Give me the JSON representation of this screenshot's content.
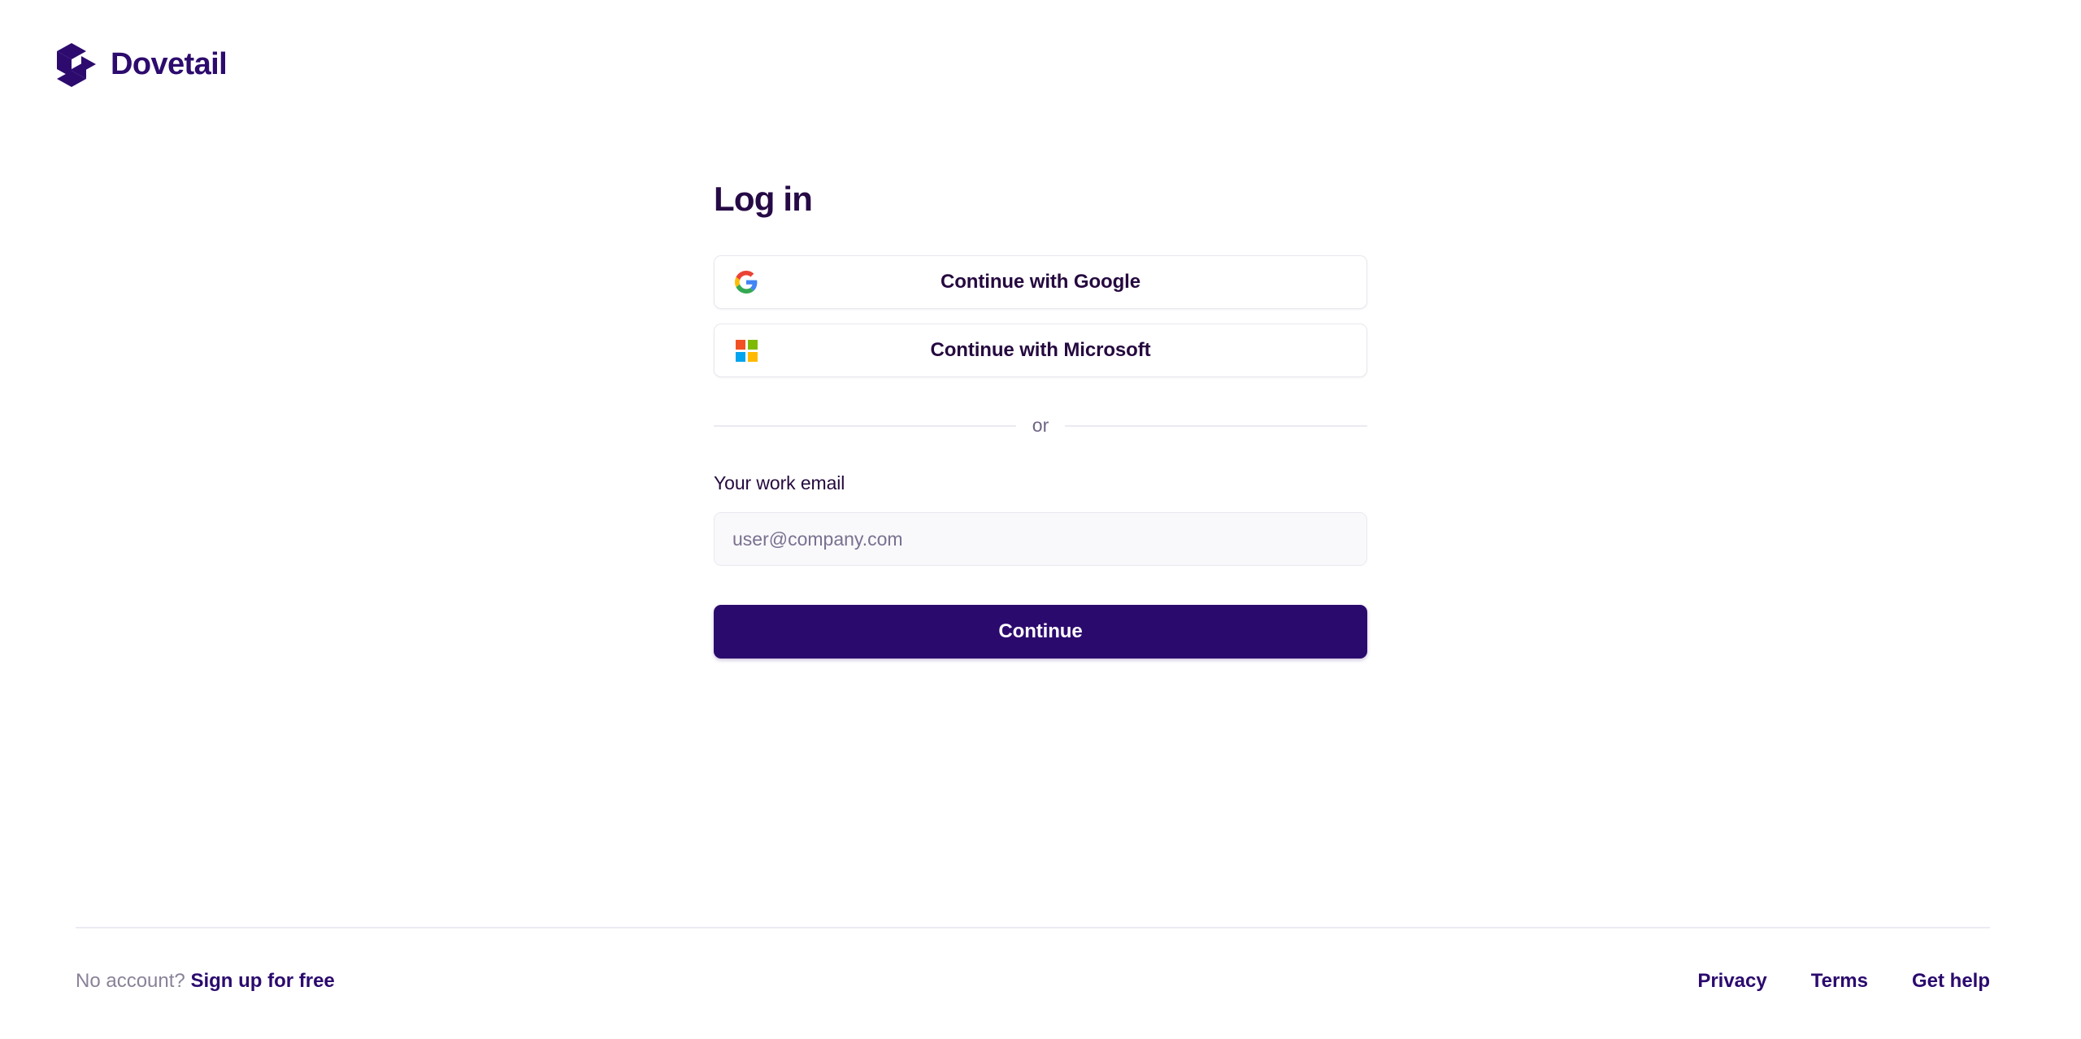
{
  "brand": {
    "name": "Dovetail",
    "logo_icon": "dovetail-logo-mark",
    "color": "#2d0b6e"
  },
  "main": {
    "title": "Log in",
    "social_buttons": [
      {
        "label": "Continue with Google",
        "icon": "google-icon"
      },
      {
        "label": "Continue with Microsoft",
        "icon": "microsoft-icon"
      }
    ],
    "divider_text": "or",
    "email_label": "Your work email",
    "email_placeholder": "user@company.com",
    "email_value": "",
    "submit_label": "Continue"
  },
  "footer": {
    "no_account_text": "No account?",
    "signup_label": "Sign up for free",
    "links": [
      {
        "label": "Privacy"
      },
      {
        "label": "Terms"
      },
      {
        "label": "Get help"
      }
    ]
  },
  "colors": {
    "primary": "#2b0a6e",
    "heading": "#260a45",
    "muted": "#8a8299",
    "placeholder": "#7a7090",
    "border": "#e9e7ef",
    "google_red": "#ea4335",
    "google_yellow": "#fbbc05",
    "google_green": "#34a853",
    "google_blue": "#4285f4",
    "ms_orange": "#f25022",
    "ms_green": "#7fba00",
    "ms_blue": "#00a4ef",
    "ms_yellow": "#ffb900"
  }
}
